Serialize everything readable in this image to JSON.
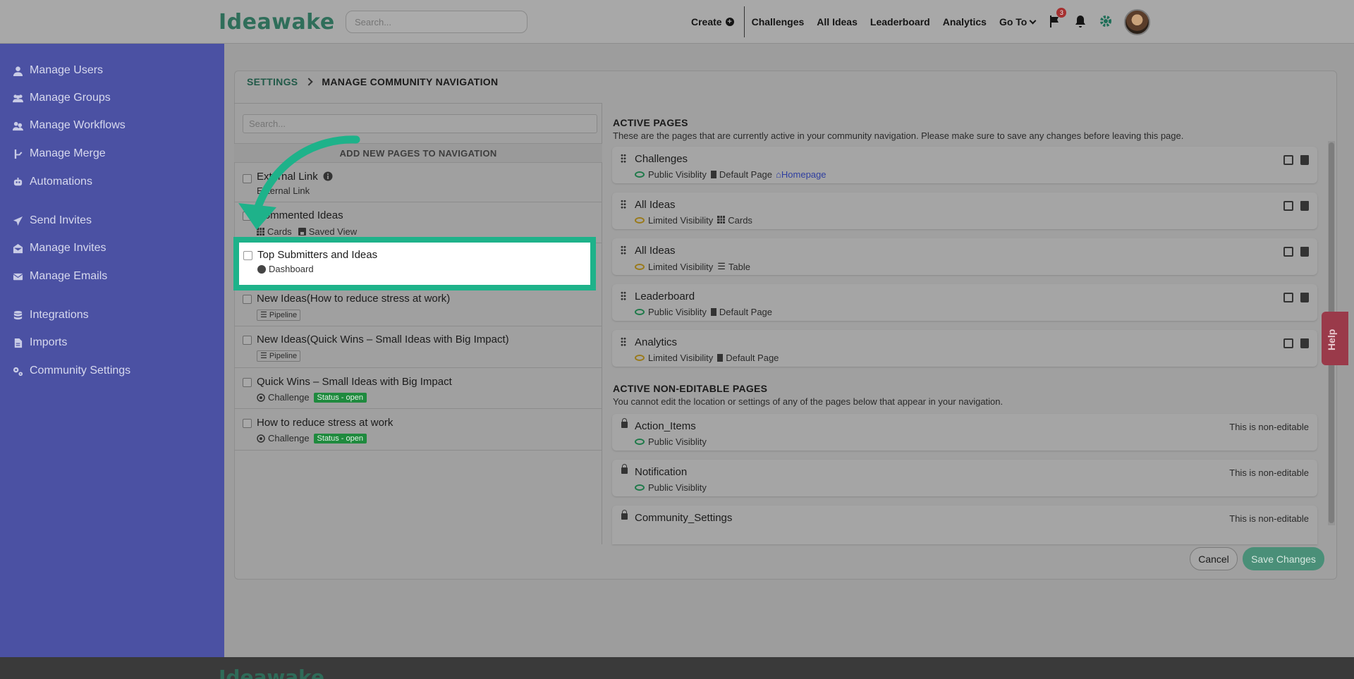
{
  "header": {
    "logo": "Ideawake",
    "search_placeholder": "Search...",
    "nav": [
      "Create",
      "Challenges",
      "All Ideas",
      "Leaderboard",
      "Analytics",
      "Go To"
    ],
    "flag_badge": "3"
  },
  "sidebar": {
    "items": [
      {
        "label": "Manage Users",
        "icon": "user-icon"
      },
      {
        "label": "Manage Groups",
        "icon": "users-icon"
      },
      {
        "label": "Manage Workflows",
        "icon": "workflow-icon"
      },
      {
        "label": "Manage Merge",
        "icon": "merge-icon"
      },
      {
        "label": "Automations",
        "icon": "robot-icon"
      },
      {
        "label": "Send Invites",
        "icon": "send-icon"
      },
      {
        "label": "Manage Invites",
        "icon": "invites-icon"
      },
      {
        "label": "Manage Emails",
        "icon": "email-icon"
      },
      {
        "label": "Integrations",
        "icon": "database-icon"
      },
      {
        "label": "Imports",
        "icon": "file-icon"
      },
      {
        "label": "Community Settings",
        "icon": "cogs-icon"
      }
    ]
  },
  "breadcrumb": {
    "root": "SETTINGS",
    "current": "MANAGE COMMUNITY NAVIGATION"
  },
  "left_panel": {
    "search_placeholder": "Search...",
    "header": "ADD NEW PAGES TO NAVIGATION",
    "rows": [
      {
        "title": "External Link",
        "meta": "External Link"
      },
      {
        "title": "Commented Ideas",
        "meta1": "Cards",
        "meta2": "Saved View"
      },
      {
        "title": "Top Submitters and Ideas",
        "meta": "Dashboard"
      },
      {
        "title": "New Ideas(How to reduce stress at work)",
        "meta": "Pipeline"
      },
      {
        "title": "New Ideas(Quick Wins – Small Ideas with Big Impact)",
        "meta": "Pipeline"
      },
      {
        "title": "Quick Wins – Small Ideas with Big Impact",
        "meta": "Challenge",
        "status": "Status - open"
      },
      {
        "title": "How to reduce stress at work",
        "meta": "Challenge",
        "status": "Status - open"
      }
    ]
  },
  "active_pages": {
    "title": "ACTIVE PAGES",
    "subtitle": "These are the pages that are currently active in your community navigation. Please make sure to save any changes before leaving this page.",
    "items": [
      {
        "title": "Challenges",
        "visibility": "Public Visiblity",
        "type": "Default Page",
        "extra": "Homepage"
      },
      {
        "title": "All Ideas",
        "visibility": "Limited Visibility",
        "type": "Cards"
      },
      {
        "title": "All Ideas",
        "visibility": "Limited Visibility",
        "type": "Table"
      },
      {
        "title": "Leaderboard",
        "visibility": "Public Visiblity",
        "type": "Default Page"
      },
      {
        "title": "Analytics",
        "visibility": "Limited Visibility",
        "type": "Default Page"
      }
    ]
  },
  "non_editable": {
    "title": "ACTIVE NON-EDITABLE PAGES",
    "subtitle": "You cannot edit the location or settings of any of the pages below that appear in your navigation.",
    "note": "This is non-editable",
    "items": [
      {
        "title": "Action_Items",
        "visibility": "Public Visiblity"
      },
      {
        "title": "Notification",
        "visibility": "Public Visiblity"
      },
      {
        "title": "Community_Settings",
        "visibility": ""
      }
    ]
  },
  "buttons": {
    "cancel": "Cancel",
    "save": "Save Changes"
  },
  "help": "Help",
  "colors": {
    "sidebar": "#4b51a3",
    "accent": "#1eb28a",
    "status": "#1f8a3e"
  }
}
